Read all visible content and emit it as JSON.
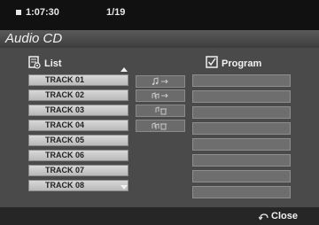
{
  "status": {
    "time": "1:07:30",
    "track_index": "1/19"
  },
  "disc_title": "Audio CD",
  "list": {
    "label": "List",
    "tracks": [
      "TRACK 01",
      "TRACK 02",
      "TRACK 03",
      "TRACK 04",
      "TRACK 05",
      "TRACK 06",
      "TRACK 07",
      "TRACK 08"
    ]
  },
  "controls": [
    {
      "name": "add-track-button",
      "icon": "music-note-arrow-icon"
    },
    {
      "name": "add-all-button",
      "icon": "music-notes-arrow-icon"
    },
    {
      "name": "delete-track-button",
      "icon": "music-note-trash-icon"
    },
    {
      "name": "delete-all-button",
      "icon": "music-notes-trash-icon"
    }
  ],
  "program": {
    "label": "Program",
    "slots": 8
  },
  "footer": {
    "close_label": "Close"
  },
  "colors": {
    "background": "#4a4a4a",
    "row": "#c8c8c8",
    "slot": "#6e6e6e"
  }
}
